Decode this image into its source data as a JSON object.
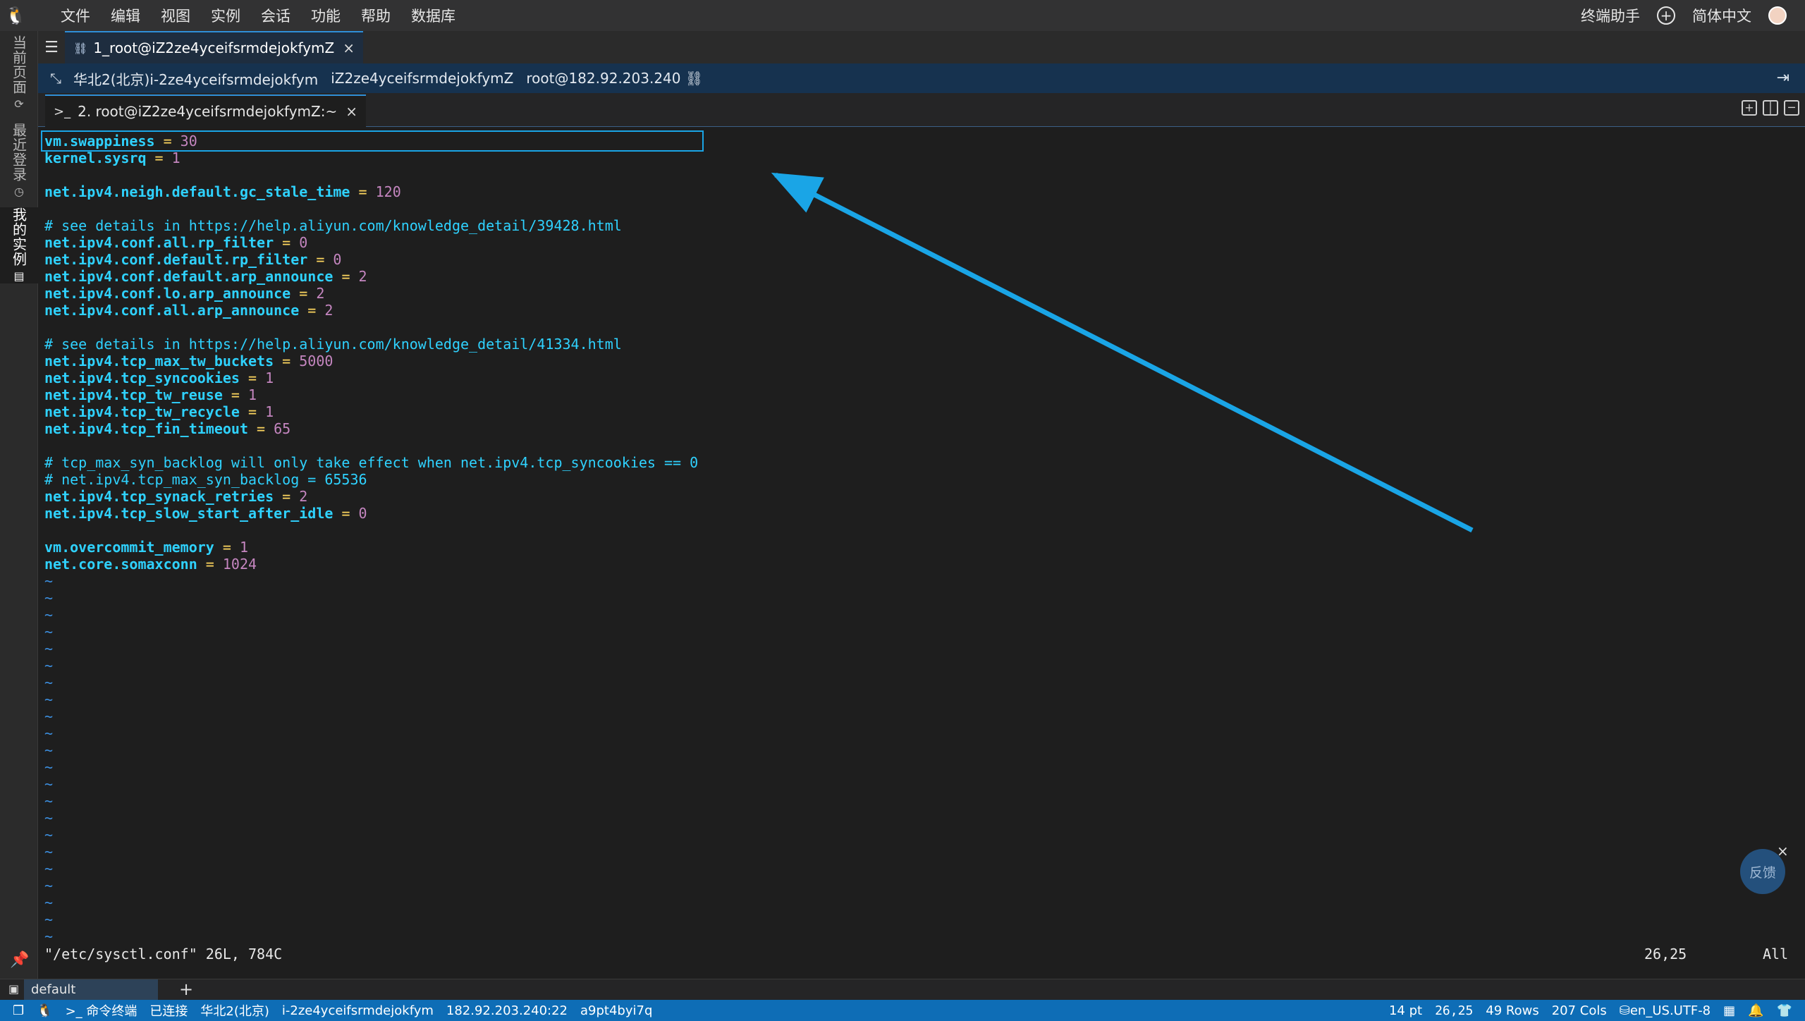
{
  "menubar": {
    "items": [
      "文件",
      "编辑",
      "视图",
      "实例",
      "会话",
      "功能",
      "帮助",
      "数据库"
    ],
    "assistant": "终端助手",
    "language": "简体中文"
  },
  "sidebar": {
    "items": [
      {
        "label": "当前页面"
      },
      {
        "label": "最近登录"
      },
      {
        "label": "我的实例"
      }
    ]
  },
  "session_tab": {
    "label": "1_root@iZ2ze4yceifsrmdejokfymZ"
  },
  "infobar": {
    "region_instance": "华北2(北京)i-2ze4yceifsrmdejokfym",
    "hostname": "iZ2ze4yceifsrmdejokfymZ",
    "user_host": "root@182.92.203.240"
  },
  "terminal_tab": {
    "label": "2. root@iZ2ze4yceifsrmdejokfymZ:~"
  },
  "editor": {
    "lines": [
      {
        "type": "kv",
        "key": "vm.swappiness",
        "value": "30"
      },
      {
        "type": "kv",
        "key": "kernel.sysrq",
        "value": "1"
      },
      {
        "type": "blank"
      },
      {
        "type": "kv",
        "key": "net.ipv4.neigh.default.gc_stale_time",
        "value": "120"
      },
      {
        "type": "blank"
      },
      {
        "type": "comment",
        "text": "# see details in https://help.aliyun.com/knowledge_detail/39428.html"
      },
      {
        "type": "kv",
        "key": "net.ipv4.conf.all.rp_filter",
        "value": "0"
      },
      {
        "type": "kv",
        "key": "net.ipv4.conf.default.rp_filter",
        "value": "0"
      },
      {
        "type": "kv",
        "key": "net.ipv4.conf.default.arp_announce",
        "value": "2"
      },
      {
        "type": "kv",
        "key": "net.ipv4.conf.lo.arp_announce",
        "value": "2"
      },
      {
        "type": "kv",
        "key": "net.ipv4.conf.all.arp_announce",
        "value": "2"
      },
      {
        "type": "blank"
      },
      {
        "type": "comment",
        "text": "# see details in https://help.aliyun.com/knowledge_detail/41334.html"
      },
      {
        "type": "kv",
        "key": "net.ipv4.tcp_max_tw_buckets",
        "value": "5000"
      },
      {
        "type": "kv",
        "key": "net.ipv4.tcp_syncookies",
        "value": "1"
      },
      {
        "type": "kv",
        "key": "net.ipv4.tcp_tw_reuse",
        "value": "1"
      },
      {
        "type": "kv",
        "key": "net.ipv4.tcp_tw_recycle",
        "value": "1"
      },
      {
        "type": "kv",
        "key": "net.ipv4.tcp_fin_timeout",
        "value": "65"
      },
      {
        "type": "blank"
      },
      {
        "type": "comment",
        "text": "# tcp_max_syn_backlog will only take effect when net.ipv4.tcp_syncookies == 0"
      },
      {
        "type": "comment",
        "text": "# net.ipv4.tcp_max_syn_backlog = 65536"
      },
      {
        "type": "kv",
        "key": "net.ipv4.tcp_synack_retries",
        "value": "2"
      },
      {
        "type": "kv",
        "key": "net.ipv4.tcp_slow_start_after_idle",
        "value": "0"
      },
      {
        "type": "blank"
      },
      {
        "type": "kv",
        "key": "vm.overcommit_memory",
        "value": "1"
      },
      {
        "type": "kv",
        "key": "net.core.somaxconn",
        "value": "1024"
      }
    ],
    "tilde_char": "~",
    "tilde_count": 22,
    "status_file": "\"/etc/sysctl.conf\" 26L, 784C",
    "status_position": "26,25",
    "status_scroll": "All"
  },
  "feedback_label": "反馈",
  "bottom_tabs": {
    "default_label": "default"
  },
  "statusbar": {
    "left": [
      "命令终端",
      "已连接",
      "华北2(北京)",
      "i-2ze4yceifsrmdejokfym",
      "182.92.203.240:22",
      "a9pt4byi7q"
    ],
    "font_size": "14 pt",
    "cursor": "26,25",
    "rows": "49 Rows",
    "cols": "207 Cols",
    "encoding": "en_US.UTF-8"
  },
  "colors": {
    "accent": "#0e6db6",
    "annotation_arrow": "#1aa5e6",
    "key": "#2fd2ff",
    "value": "#c586c0",
    "equals": "#ffd75f"
  }
}
